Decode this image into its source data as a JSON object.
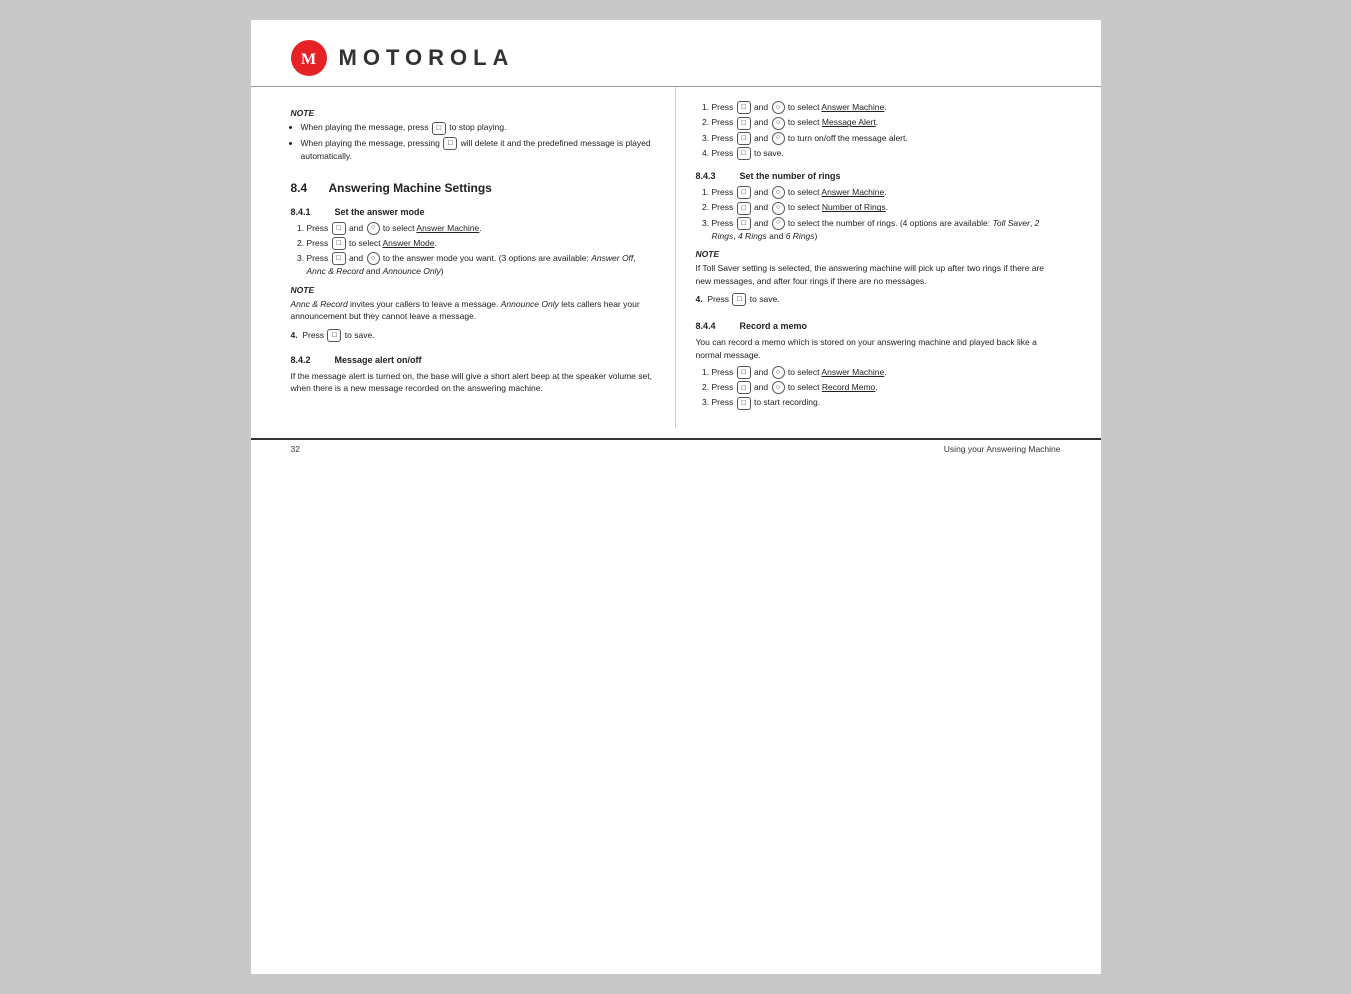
{
  "header": {
    "logo_letter": "M",
    "brand_name": "MOTOROLA"
  },
  "left_column": {
    "note_intro": {
      "label": "NOTE",
      "bullets": [
        "When playing the message, press  to stop playing.",
        "When playing the message, pressing  will delete it and the predefined message is played automatically."
      ]
    },
    "section_8_4": {
      "number": "8.4",
      "title": "Answering Machine Settings"
    },
    "section_8_4_1": {
      "number": "8.4.1",
      "title": "Set the answer mode",
      "steps": [
        "Press  and  to select Answer Machine.",
        "Press  to select Answer Mode.",
        "Press  and  to the answer mode you want. (3 options are available: Answer Off, Annc & Record and Announce Only)"
      ],
      "note": {
        "label": "NOTE",
        "text": "Annc & Record invites your callers to leave a message. Announce Only lets callers hear your announcement but they cannot leave a message."
      },
      "step4": "Press  to save."
    },
    "section_8_4_2": {
      "number": "8.4.2",
      "title": "Message alert on/off",
      "text": "If the message alert is turned on, the base will give a short alert beep at the speaker volume set, when there is a new message recorded on the answering machine."
    }
  },
  "right_column": {
    "section_8_4_2_steps": {
      "steps": [
        "Press  and  to select Answer Machine.",
        "Press  and  to select Message Alert.",
        "Press  and  to turn on/off the message alert.",
        "Press  to save."
      ]
    },
    "section_8_4_3": {
      "number": "8.4.3",
      "title": "Set the number of rings",
      "steps": [
        "Press  and  to select Answer Machine.",
        "Press  and  to select Number of Rings.",
        "Press  and  to select the number of rings. (4 options are available: Toll Saver, 2 Rings, 4 Rings and 6 Rings)"
      ],
      "note": {
        "label": "NOTE",
        "text": "If Toll Saver setting is selected, the answering machine will pick up after two rings if there are new messages, and after four rings if there are no messages."
      },
      "step4": "Press  to save."
    },
    "section_8_4_4": {
      "number": "8.4.4",
      "title": "Record a memo",
      "intro": "You can record a memo which is stored on your answering machine and played back like a normal message.",
      "steps": [
        "Press  and  to select Answer Machine.",
        "Press  and  to select Record Memo.",
        "Press  to start recording."
      ]
    }
  },
  "footer": {
    "page_number": "32",
    "section_label": "Using your Answering Machine"
  }
}
